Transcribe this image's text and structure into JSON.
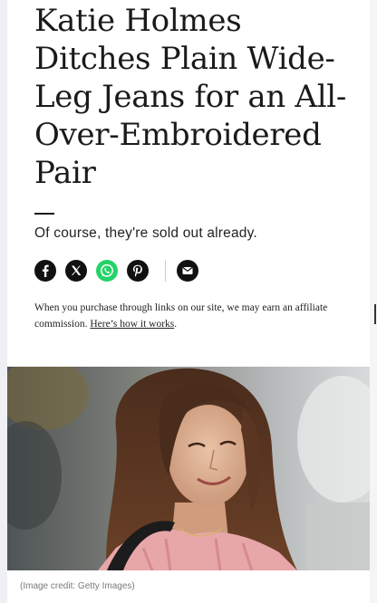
{
  "article": {
    "headline_lines": [
      "Katie Holmes",
      "Ditches Plain Wide-",
      "Leg Jeans for an All-",
      "Over-Embroidered",
      "Pair"
    ],
    "subhead": "Of course, they're sold out already.",
    "share_icons": [
      "facebook-icon",
      "x-icon",
      "whatsapp-icon",
      "pinterest-icon",
      "email-icon"
    ],
    "affiliate_text": "When you purchase through links on our site, we may earn an affiliate commission.",
    "affiliate_link": "Here’s how it works",
    "affiliate_end": ".",
    "image_credit": "(Image credit: Getty Images)"
  },
  "colors": {
    "text": "#1a1a1a",
    "whatsapp": "#25d366",
    "icon_dark": "#111111"
  }
}
